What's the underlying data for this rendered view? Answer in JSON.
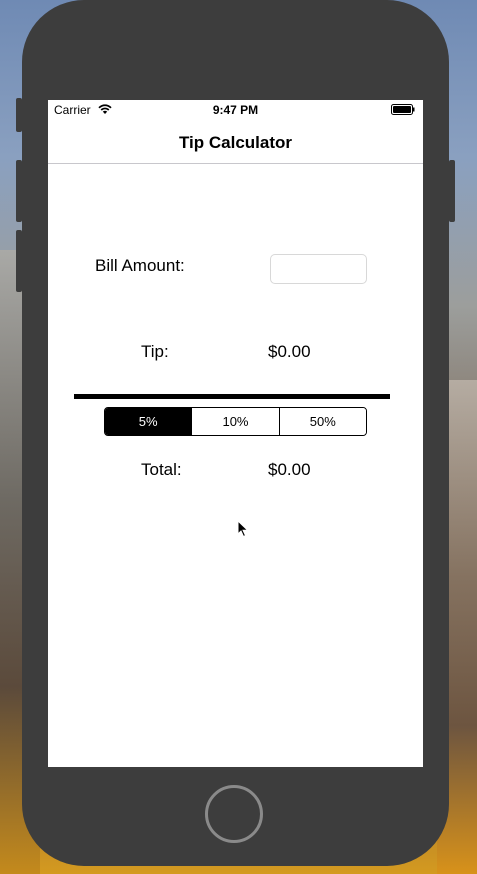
{
  "status_bar": {
    "carrier": "Carrier",
    "time": "9:47 PM",
    "wifi_icon": "wifi-icon",
    "battery_icon": "battery-full-icon"
  },
  "nav": {
    "title": "Tip Calculator"
  },
  "form": {
    "bill_label": "Bill Amount:",
    "bill_value": "",
    "tip_label": "Tip:",
    "tip_value": "$0.00",
    "segments": [
      "5%",
      "10%",
      "50%"
    ],
    "selected_segment": "5%",
    "total_label": "Total:",
    "total_value": "$0.00"
  },
  "colors": {
    "phone_frame": "#3d3d3d",
    "screen_bg": "#ffffff",
    "selected_segment_bg": "#000000"
  }
}
